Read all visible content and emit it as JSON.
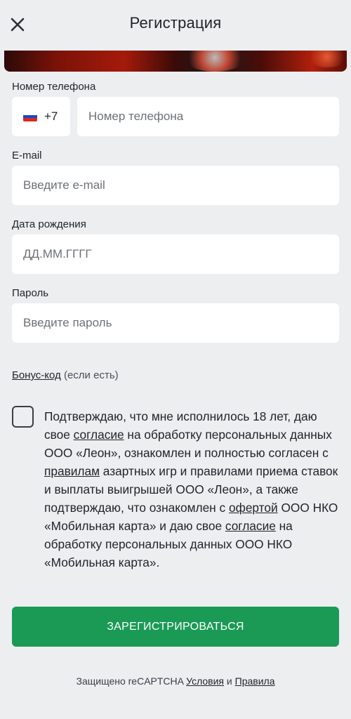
{
  "header": {
    "title": "Регистрация",
    "close_icon": "close-icon"
  },
  "phone": {
    "label": "Номер телефона",
    "country_code": "+7",
    "flag_icon": "russia-flag-icon",
    "placeholder": "Номер телефона"
  },
  "email": {
    "label": "E-mail",
    "placeholder": "Введите e-mail"
  },
  "birthdate": {
    "label": "Дата рождения",
    "placeholder": "ДД.ММ.ГГГГ"
  },
  "password": {
    "label": "Пароль",
    "placeholder": "Введите пароль"
  },
  "bonus": {
    "link": "Бонус-код",
    "note": " (если есть)"
  },
  "consent": {
    "p1": "Подтверждаю, что мне исполнилось 18 лет, даю свое ",
    "link1": "согласие",
    "p2": " на обработку персональных данных ООО «Леон», ознакомлен и полностью согласен с ",
    "link2": "правилам",
    "p3": " азартных игр и правилами приема ставок и выплаты выигрышей ООО «Леон», а также подтверждаю, что ознакомлен с ",
    "link3": "офертой",
    "p4": " ООО НКО «Мобильная карта» и даю свое ",
    "link4": "согласие",
    "p5": " на обработку персональных данных ООО НКО «Мобильная карта»."
  },
  "register_button": "ЗАРЕГИСТРИРОВАТЬСЯ",
  "footer": {
    "text": "Защищено reCAPTCHA ",
    "terms": "Условия",
    "and": " и ",
    "rules": "Правила"
  },
  "colors": {
    "background": "#eceef0",
    "button": "#1a9a55",
    "field": "#ffffff"
  }
}
